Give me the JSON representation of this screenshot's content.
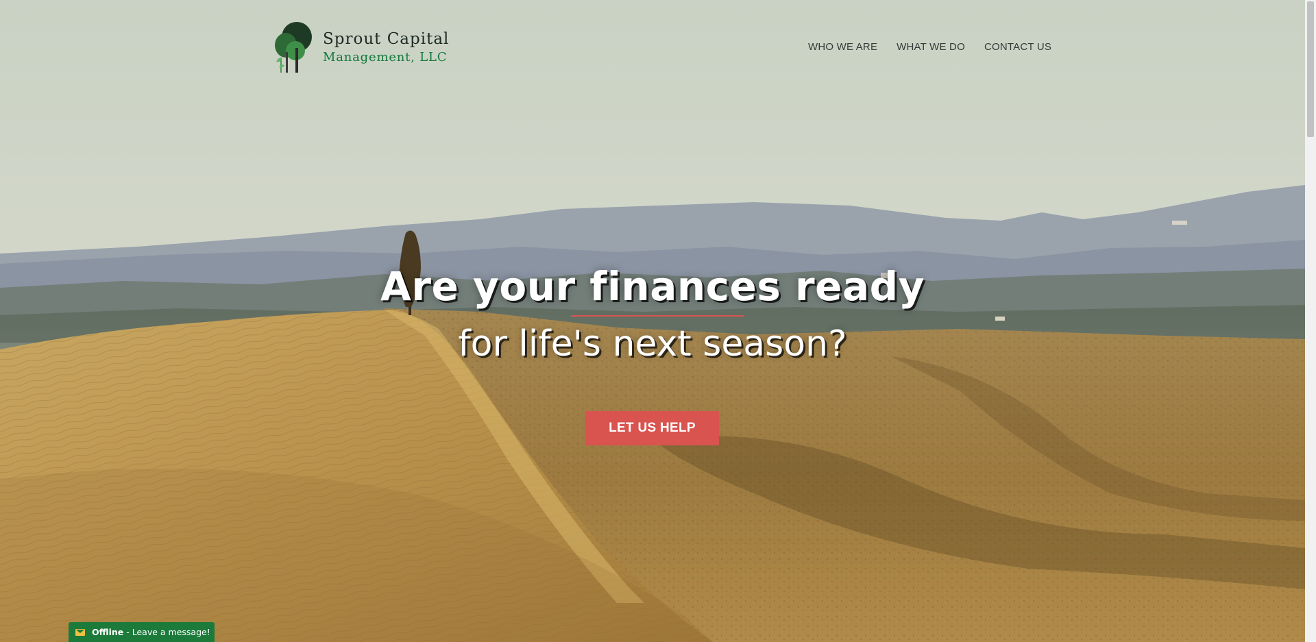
{
  "brand": {
    "name_line1": "Sprout Capital",
    "name_line2": "Management, LLC"
  },
  "nav": {
    "items": [
      {
        "label": "WHO WE ARE"
      },
      {
        "label": "WHAT WE DO"
      },
      {
        "label": "CONTACT US"
      }
    ]
  },
  "hero": {
    "headline": "Are your finances ready",
    "subheadline": "for life's next season?",
    "cta_label": "LET US HELP",
    "accent_color": "#d9534f"
  },
  "chat": {
    "status": "Offline",
    "message": "- Leave a message!",
    "icon": "envelope-icon",
    "color": "#1c7a3a"
  }
}
